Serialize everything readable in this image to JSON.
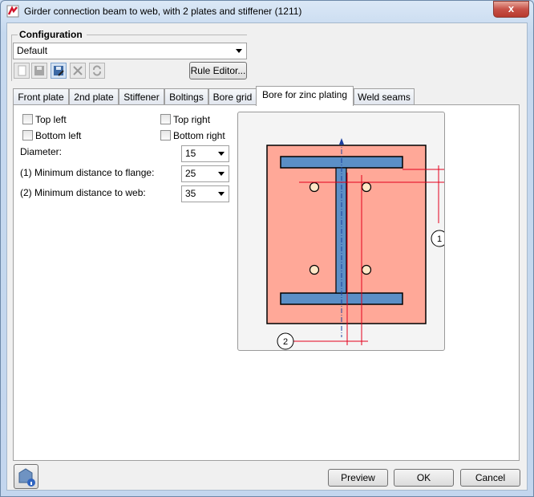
{
  "window": {
    "title": "Girder connection beam to web, with 2 plates and stiffener (1211)",
    "close_glyph": "x"
  },
  "configuration": {
    "title": "Configuration",
    "selected": "Default",
    "toolbar_icons": [
      "new-icon",
      "save-icon",
      "save-as-icon",
      "delete-icon",
      "refresh-icon"
    ],
    "rule_editor_label": "Rule Editor..."
  },
  "tabs": [
    {
      "label": "Front plate",
      "active": false
    },
    {
      "label": "2nd plate",
      "active": false
    },
    {
      "label": "Stiffener",
      "active": false
    },
    {
      "label": "Boltings",
      "active": false
    },
    {
      "label": "Bore grid",
      "active": false
    },
    {
      "label": "Bore for zinc plating",
      "active": true
    },
    {
      "label": "Weld seams",
      "active": false
    }
  ],
  "options": {
    "top_left": "Top left",
    "top_right": "Top right",
    "bottom_left": "Bottom left",
    "bottom_right": "Bottom right"
  },
  "fields": {
    "diameter": {
      "label": "Diameter:",
      "value": "15"
    },
    "dist_flange": {
      "label": "(1) Minimum distance to flange:",
      "value": "25"
    },
    "dist_web": {
      "label": "(2) Minimum distance to web:",
      "value": "35"
    }
  },
  "diagram": {
    "marker1": "1",
    "marker2": "2"
  },
  "buttons": {
    "preview": "Preview",
    "ok": "OK",
    "cancel": "Cancel"
  },
  "colors": {
    "plate": "#ffa898",
    "beam": "#5b8fc6",
    "dimension": "#e3001b"
  }
}
